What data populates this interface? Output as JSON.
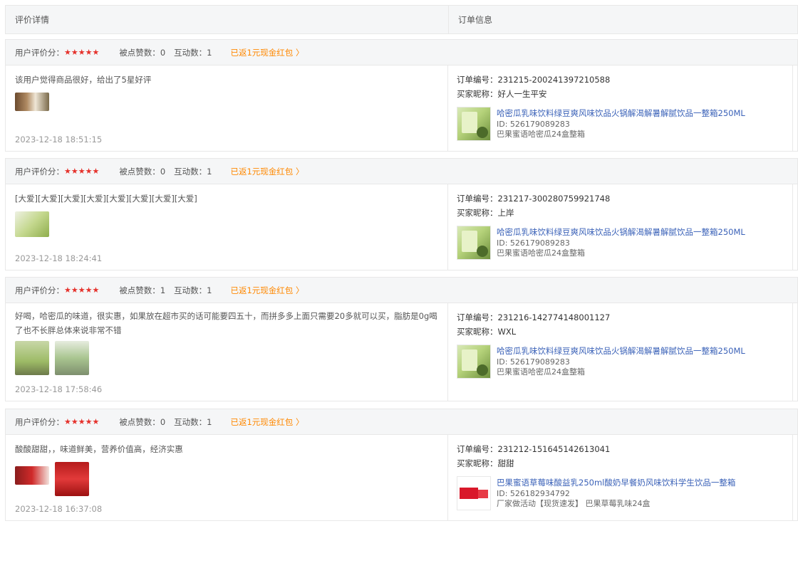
{
  "header": {
    "col1": "评价详情",
    "col2": "订单信息"
  },
  "labels": {
    "rating_label": "用户评价分：",
    "stars": "★★★★★",
    "likes_label": "被点赞数：",
    "interact_label": "互动数：",
    "order_label": "订单编号：",
    "buyer_label": "买家昵称："
  },
  "reviews": [
    {
      "likes": "0",
      "interactions": "1",
      "reward": "已返1元现金红包 〉",
      "text": "该用户觉得商品很好，给出了5星好评",
      "time": "2023-12-18 18:51:15",
      "order": "231215-200241397210588",
      "buyer": "好人一生平安",
      "product_title": "哈密瓜乳味饮料绿豆爽风味饮品火锅解渴解暑解腻饮品一整箱250ML",
      "product_id": "ID: 526179089283",
      "product_sku": "巴果蜜语哈密瓜24盒整箱"
    },
    {
      "likes": "0",
      "interactions": "1",
      "reward": "已返1元现金红包 〉",
      "text": "[大爱][大爱][大爱][大爱][大爱][大爱][大爱][大爱]",
      "time": "2023-12-18 18:24:41",
      "order": "231217-300280759921748",
      "buyer": "上岸",
      "product_title": "哈密瓜乳味饮料绿豆爽风味饮品火锅解渴解暑解腻饮品一整箱250ML",
      "product_id": "ID: 526179089283",
      "product_sku": "巴果蜜语哈密瓜24盒整箱"
    },
    {
      "likes": "1",
      "interactions": "1",
      "reward": "已返1元现金红包 〉",
      "text": "好喝，哈密瓜的味道，很实惠，如果放在超市买的话可能要四五十，而拼多多上面只需要20多就可以买，脂肪是0g喝了也不长胖总体来说非常不错",
      "time": "2023-12-18 17:58:46",
      "order": "231216-142774148001127",
      "buyer": "WXL",
      "product_title": "哈密瓜乳味饮料绿豆爽风味饮品火锅解渴解暑解腻饮品一整箱250ML",
      "product_id": "ID: 526179089283",
      "product_sku": "巴果蜜语哈密瓜24盒整箱"
    },
    {
      "likes": "0",
      "interactions": "1",
      "reward": "已返1元现金红包 〉",
      "text": "酸酸甜甜，，味道鲜美，营养价值高，经济实惠",
      "time": "2023-12-18 16:37:08",
      "order": "231212-151645142613041",
      "buyer": "甜甜",
      "product_title": "巴果蜜语草莓味酸益乳250ml酸奶早餐奶风味饮料学生饮品一整箱",
      "product_id": "ID: 526182934792",
      "product_sku": "厂家做活动【现货速发】 巴果草莓乳味24盒"
    }
  ],
  "colors": {
    "accent_red": "#e5312b",
    "reward_orange": "#ff8800",
    "link_blue": "#3b62b8"
  }
}
